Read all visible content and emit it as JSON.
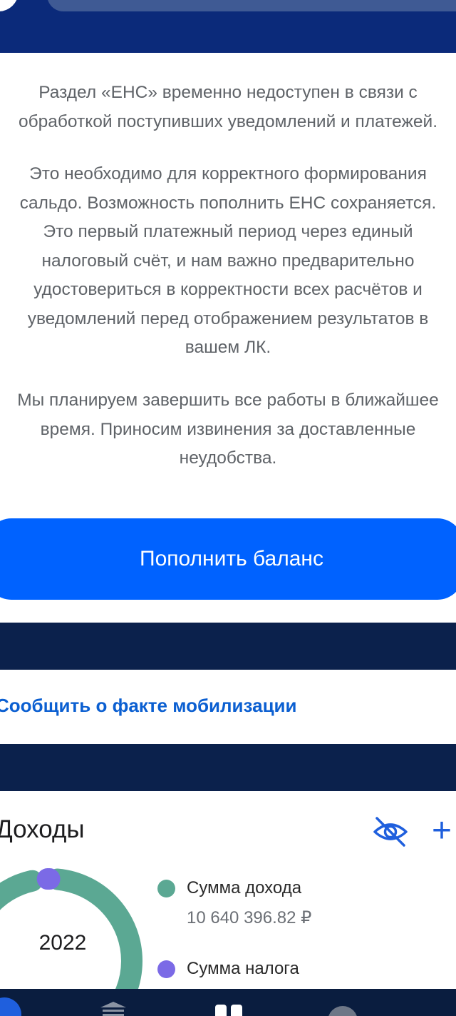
{
  "notice": {
    "paragraph1": [
      "Раздел «ЕНС» временно недоступен в связи с",
      "обработкой поступивших уведомлений и платежей."
    ],
    "paragraph2": [
      "Это необходимо для корректного формирования",
      "сальдо. Возможность пополнить ЕНС сохраняется.",
      "Это первый платежный период через единый",
      "налоговый счёт, и нам важно предварительно",
      "удостовериться в корректности всех расчётов и",
      "уведомлений перед отображением результатов в",
      "вашем ЛК."
    ],
    "paragraph3": [
      "Мы планируем завершить все работы в ближайшее",
      "время. Приносим извинения за доставленные",
      "неудобства."
    ],
    "topup_button": "Пополнить баланс"
  },
  "mobilization_link": "Сообщить о факте мобилизации",
  "income": {
    "title": "Доходы",
    "year": "2022",
    "income_label": "Сумма дохода",
    "income_value": "10 640 396.82 ₽",
    "tax_label": "Сумма налога",
    "income_share": 0.98,
    "tax_share": 0.02
  },
  "colors": {
    "header_bg": "#0b2a7a",
    "primary_button": "#0062ff",
    "link": "#0b5fd1",
    "income_color": "#5ba893",
    "tax_color": "#7b6ae6",
    "separator": "#0b214c"
  },
  "icons": [
    "eye-off-icon",
    "plus-icon",
    "logo-icon",
    "home-icon",
    "bank-icon",
    "apps-icon",
    "profile-icon"
  ]
}
